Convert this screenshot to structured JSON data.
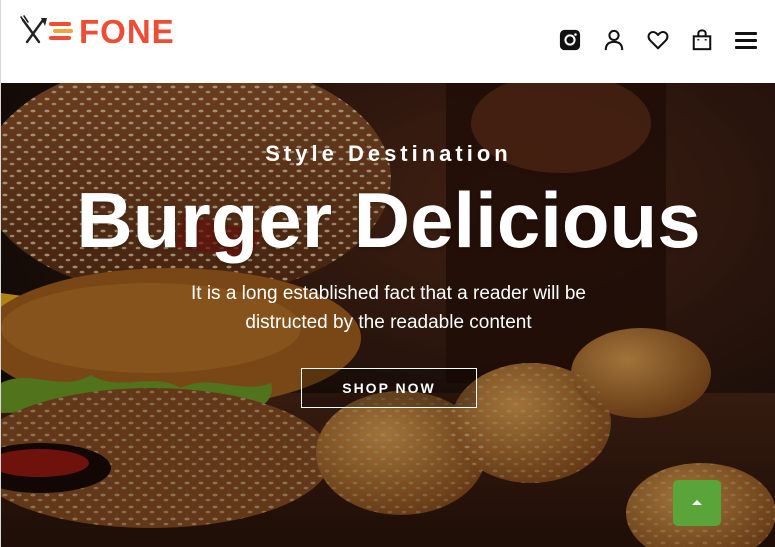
{
  "brand": {
    "name": "FONE",
    "logo_icon": "fork-knife-speed-icon",
    "color": "#ee4d35"
  },
  "header": {
    "icons": [
      {
        "name": "instagram-icon"
      },
      {
        "name": "user-icon"
      },
      {
        "name": "heart-icon"
      },
      {
        "name": "shopping-bag-icon"
      },
      {
        "name": "menu-icon"
      }
    ]
  },
  "hero": {
    "kicker": "Style Destination",
    "title": "Burger Delicious",
    "description_line1": "It is a long established fact that a reader will be",
    "description_line2": "distructed by the readable content",
    "cta_label": "SHOP NOW",
    "image": "burger-and-nuggets-photo"
  },
  "scroll_top": {
    "icon": "chevron-up-icon",
    "color": "#5aa53a"
  }
}
